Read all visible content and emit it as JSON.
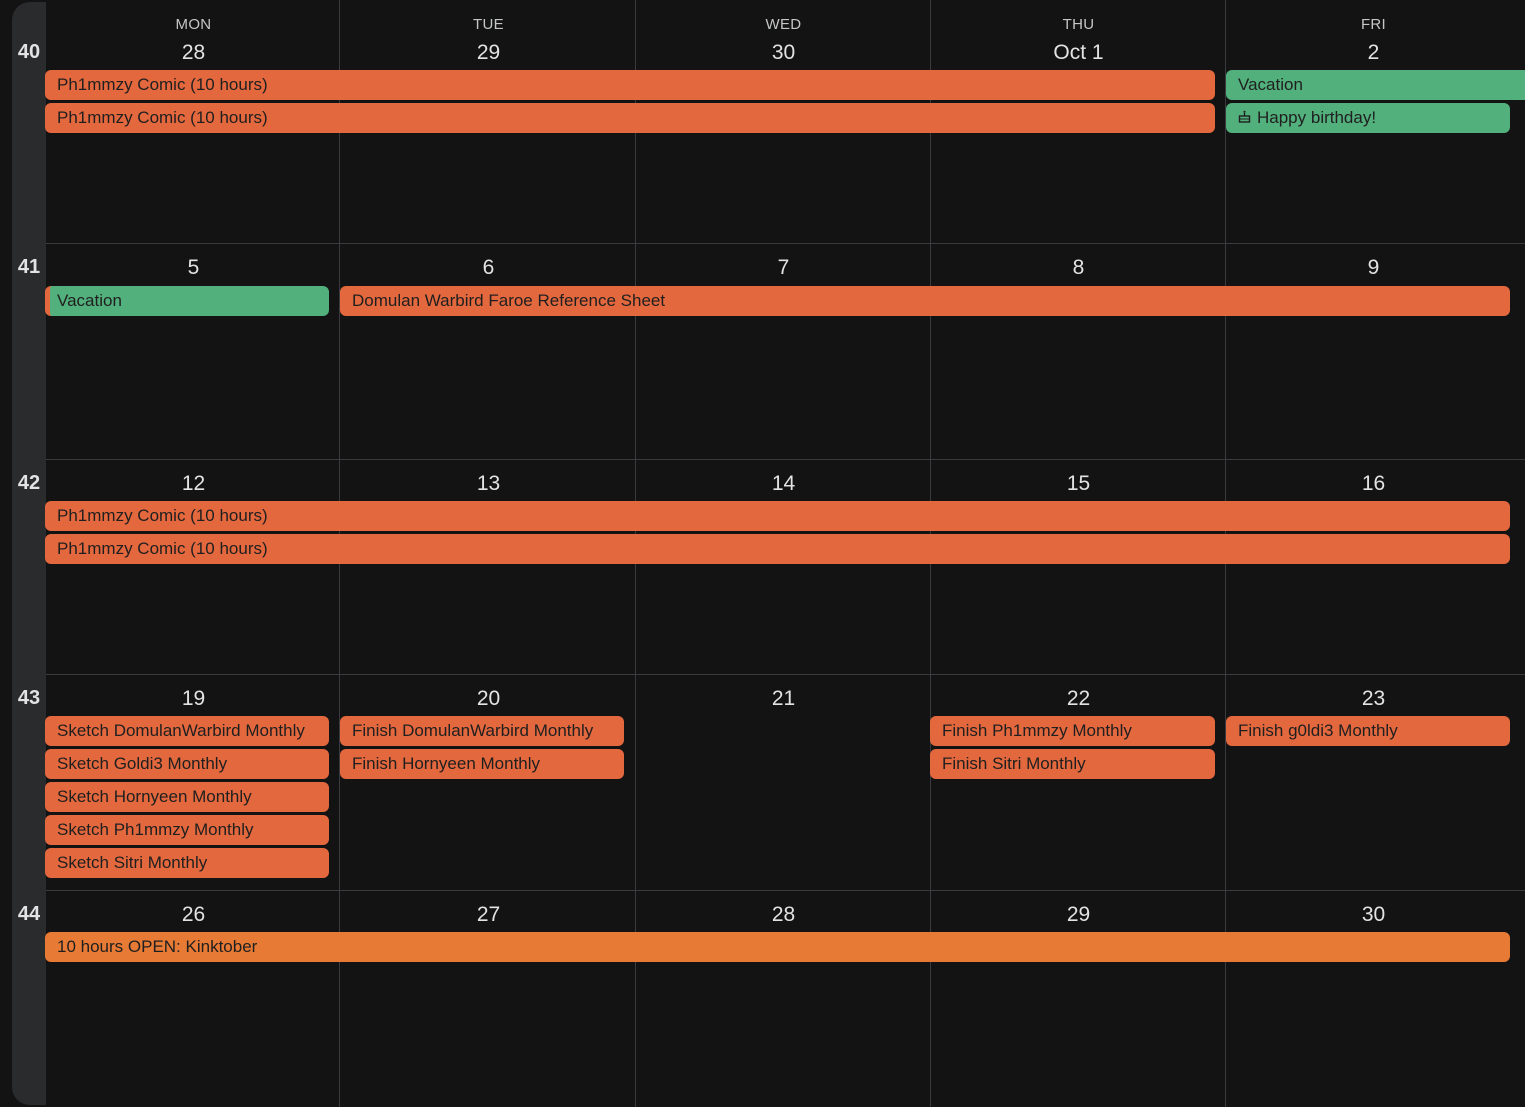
{
  "headers": [
    {
      "dow": "MON",
      "day": "28"
    },
    {
      "dow": "TUE",
      "day": "29"
    },
    {
      "dow": "WED",
      "day": "30"
    },
    {
      "dow": "THU",
      "day": "Oct 1"
    },
    {
      "dow": "FRI",
      "day": "2"
    }
  ],
  "weeks": [
    {
      "number": "40"
    },
    {
      "number": "41",
      "days": [
        "5",
        "6",
        "7",
        "8",
        "9"
      ]
    },
    {
      "number": "42",
      "days": [
        "12",
        "13",
        "14",
        "15",
        "16"
      ]
    },
    {
      "number": "43",
      "days": [
        "19",
        "20",
        "21",
        "22",
        "23"
      ]
    },
    {
      "number": "44",
      "days": [
        "26",
        "27",
        "28",
        "29",
        "30"
      ]
    }
  ],
  "events": {
    "w40_comic_a": "Ph1mmzy Comic (10 hours)",
    "w40_comic_b": "Ph1mmzy Comic (10 hours)",
    "w40_vacation": "Vacation",
    "w40_birthday": "Happy birthday!",
    "w41_vacation": "Vacation",
    "w41_reference": "Domulan Warbird Faroe Reference Sheet",
    "w42_comic_a": "Ph1mmzy Comic (10 hours)",
    "w42_comic_b": "Ph1mmzy Comic (10 hours)",
    "w43_mon": [
      "Sketch DomulanWarbird Monthly",
      "Sketch Goldi3 Monthly",
      "Sketch Hornyeen Monthly",
      "Sketch Ph1mmzy Monthly",
      "Sketch Sitri Monthly"
    ],
    "w43_tue": [
      "Finish DomulanWarbird Monthly",
      "Finish Hornyeen Monthly"
    ],
    "w43_thu": [
      "Finish Ph1mmzy Monthly",
      "Finish Sitri Monthly"
    ],
    "w43_fri": [
      "Finish g0ldi3 Monthly"
    ],
    "w44_kinktober": "10 hours OPEN: Kinktober"
  },
  "colors": {
    "background": "#131314",
    "event_orange": "#e4683e",
    "event_green": "#52b07c",
    "event_amber": "#e77a35"
  },
  "icons": {
    "birthday": "cake-icon"
  }
}
